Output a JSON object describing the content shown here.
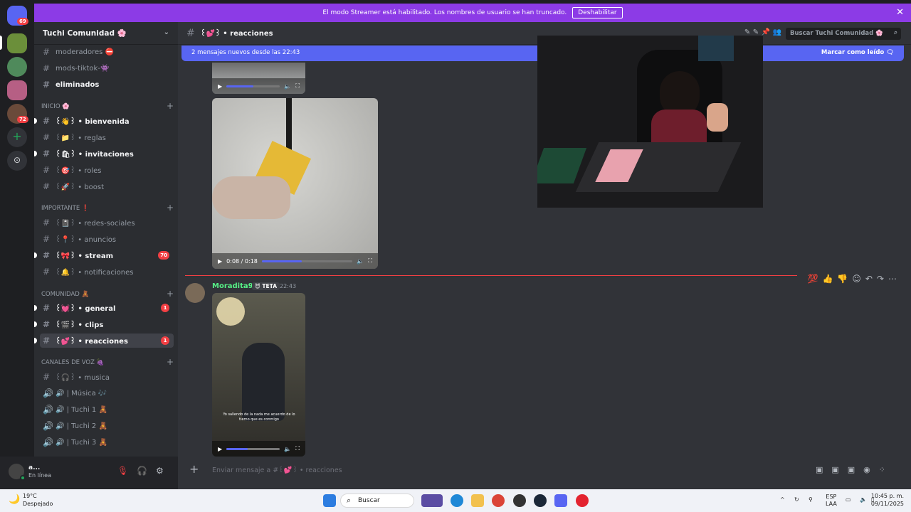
{
  "banner": {
    "text": "El modo Streamer está habilitado. Los nombres de usuario se han truncado.",
    "button": "Deshabilitar",
    "close": "✕"
  },
  "rail": {
    "home_badge": "69",
    "dm_badge": "72"
  },
  "server": {
    "name": "Tuchi Comunidad 🌸",
    "chevron": "⌄"
  },
  "channels": [
    {
      "label": "moderadores ⛔",
      "style": "muted"
    },
    {
      "label": "mods-tiktok-👾",
      "style": "muted"
    },
    {
      "label": "eliminados",
      "style": "bold"
    },
    {
      "category": "INICIO 🌸"
    },
    {
      "label": "꒰👋꒱ • bienvenida",
      "style": "bold",
      "unread": true
    },
    {
      "label": "꒰📁꒱ • reglas",
      "style": "muted"
    },
    {
      "label": "꒰🛍꒱ • invitaciones",
      "style": "bold",
      "unread": true
    },
    {
      "label": "꒰🎯꒱ • roles",
      "style": "muted"
    },
    {
      "label": "꒰🚀꒱ • boost",
      "style": "muted"
    },
    {
      "category": "IMPORTANTE ❗"
    },
    {
      "label": "꒰📓꒱ • redes-sociales",
      "style": "muted"
    },
    {
      "label": "꒰📍꒱ • anuncios",
      "style": "muted"
    },
    {
      "label": "꒰🎀꒱ • stream",
      "style": "bold",
      "unread": true,
      "count": "70"
    },
    {
      "label": "꒰🔔꒱ • notificaciones",
      "style": "muted"
    },
    {
      "category": "COMUNIDAD 🧸"
    },
    {
      "label": "꒰💓꒱ • general",
      "style": "bold",
      "unread": true,
      "count": "1"
    },
    {
      "label": "꒰🎬꒱ • clips",
      "style": "bold",
      "unread": true
    },
    {
      "label": "꒰💕꒱ • reacciones",
      "style": "selected",
      "unread": true,
      "count": "1"
    },
    {
      "category": "CANALES DE VOZ 🍇"
    },
    {
      "label": "꒰🎧꒱ • musica",
      "style": "muted"
    },
    {
      "label": "🔊 | Música 🎶",
      "style": "muted",
      "voice": true
    },
    {
      "label": "🔊 | Tuchi 1 🧸",
      "style": "muted",
      "voice": true
    },
    {
      "label": "🔊 | Tuchi 2 🧸",
      "style": "muted",
      "voice": true
    },
    {
      "label": "🔊 | Tuchi 3 🧸",
      "style": "muted",
      "voice": true
    }
  ],
  "user": {
    "name": "a...",
    "status": "En línea"
  },
  "topbar": {
    "channel": "꒰💕꒱ • reacciones",
    "search_placeholder": "Buscar Tuchi Comunidad 🌸"
  },
  "newbar": {
    "text": "2 mensajes nuevos desde las 22:43",
    "mark": "Marcar como leído 🗨"
  },
  "video1": {
    "time": "0:08 / 0:18",
    "progress": 0.44
  },
  "message": {
    "author": "Moradita97",
    "tag": "😈 TETA",
    "time": "22:43",
    "video_caption": "Yo saliendo de la nada me acuerdo de lo tierno que es conmigo"
  },
  "composer": {
    "placeholder": "Enviar mensaje a #꒰💕꒱ • reacciones"
  },
  "taskbar": {
    "temp": "19°C",
    "weather": "Despejado",
    "search": "Buscar",
    "lang1": "ESP",
    "lang2": "LAA",
    "time": "10:45 p. m.",
    "date": "09/11/2025"
  }
}
